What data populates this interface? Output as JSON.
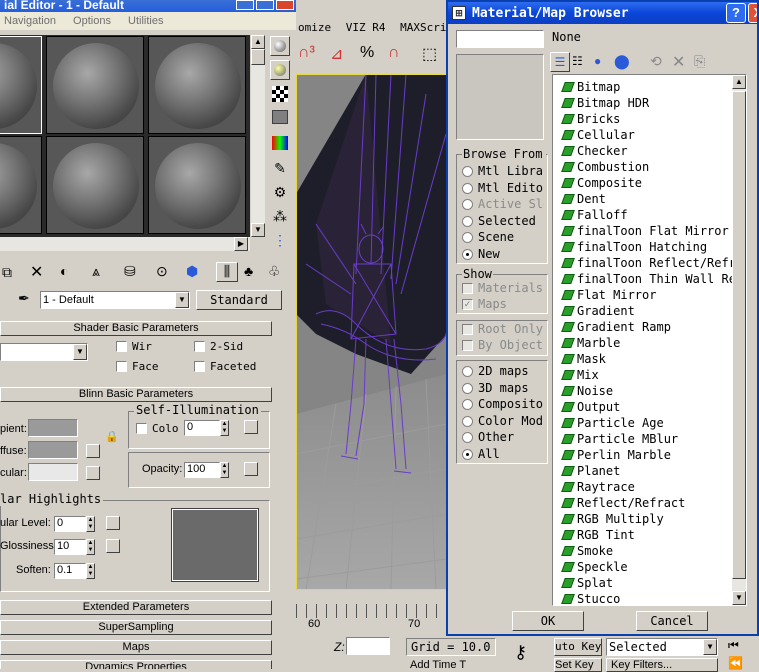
{
  "material_editor": {
    "title": "ial Editor - 1 - Default",
    "menu": [
      "Navigation",
      "Options",
      "Utilities"
    ],
    "material_name": "1 - Default",
    "material_type": "Standard",
    "rollouts": {
      "shader_basic": "Shader Basic Parameters",
      "blinn_basic": "Blinn Basic Parameters",
      "extended": "Extended Parameters",
      "supersampling": "SuperSampling",
      "maps": "Maps",
      "dynamics": "Dynamics Properties"
    },
    "shader_options": {
      "wire": "Wir",
      "two_sided": "2-Sid",
      "face_map": "Face",
      "faceted": "Faceted"
    },
    "blinn": {
      "ambient_label": "pient:",
      "diffuse_label": "ffuse:",
      "specular_label": "cular:",
      "self_illum_title": "Self-Illumination",
      "color_label": "Colo",
      "self_illum_value": "0",
      "opacity_label": "Opacity:",
      "opacity_value": "100"
    },
    "specular": {
      "title": "lar Highlights",
      "level_label": "ular Level:",
      "level_value": "0",
      "gloss_label": "Glossiness:",
      "gloss_value": "10",
      "soften_label": "Soften:",
      "soften_value": "0.1"
    }
  },
  "viewport": {
    "menu": [
      "omize",
      "VIZ R4",
      "MAXScript"
    ],
    "ruler": [
      "60",
      "70"
    ],
    "z_label": "Z:",
    "grid": "Grid = 10.0",
    "auto_key": "uto Key",
    "selected": "Selected",
    "set_key": "Set Key",
    "key_filters": "Key Filters...",
    "add_time": "Add Time T"
  },
  "browser": {
    "title": "Material/Map Browser",
    "name_field": "",
    "none_label": "None",
    "browse_from_title": "Browse From",
    "browse_from": [
      {
        "label": "Mtl Library",
        "selected": false,
        "enabled": true
      },
      {
        "label": "Mtl Editor",
        "selected": false,
        "enabled": true
      },
      {
        "label": "Active Slot",
        "selected": false,
        "enabled": false
      },
      {
        "label": "Selected",
        "selected": false,
        "enabled": true
      },
      {
        "label": "Scene",
        "selected": false,
        "enabled": true
      },
      {
        "label": "New",
        "selected": true,
        "enabled": true
      }
    ],
    "show_title": "Show",
    "show": [
      {
        "label": "Materials",
        "checked": false,
        "enabled": false
      },
      {
        "label": "Maps",
        "checked": true,
        "enabled": false
      }
    ],
    "root_only": "Root Only",
    "by_object": "By Object",
    "map_types": [
      {
        "label": "2D maps",
        "selected": false
      },
      {
        "label": "3D maps",
        "selected": false
      },
      {
        "label": "Compositors",
        "selected": false
      },
      {
        "label": "Color Mods",
        "selected": false
      },
      {
        "label": "Other",
        "selected": false
      },
      {
        "label": "All",
        "selected": true
      }
    ],
    "items": [
      "Bitmap",
      "Bitmap HDR",
      "Bricks",
      "Cellular",
      "Checker",
      "Combustion",
      "Composite",
      "Dent",
      "Falloff",
      "finalToon Flat Mirror",
      "finalToon Hatching",
      "finalToon Reflect/Refract",
      "finalToon Thin Wall Refraction",
      "Flat Mirror",
      "Gradient",
      "Gradient Ramp",
      "Marble",
      "Mask",
      "Mix",
      "Noise",
      "Output",
      "Particle Age",
      "Particle MBlur",
      "Perlin Marble",
      "Planet",
      "Raytrace",
      "Reflect/Refract",
      "RGB Multiply",
      "RGB Tint",
      "Smoke",
      "Speckle",
      "Splat",
      "Stucco"
    ],
    "ok_label": "OK",
    "cancel_label": "Cancel",
    "help_label": "?",
    "close_label": "X"
  }
}
